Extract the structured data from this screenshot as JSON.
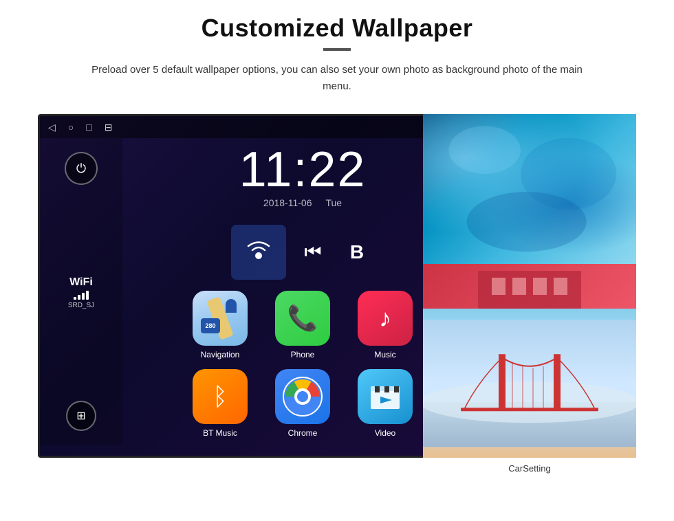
{
  "page": {
    "title": "Customized Wallpaper",
    "description": "Preload over 5 default wallpaper options, you can also set your own photo as background photo of the main menu."
  },
  "screen": {
    "time": "11:22",
    "date": "2018-11-06",
    "day": "Tue",
    "wifi_label": "WiFi",
    "wifi_ssid": "SRD_SJ"
  },
  "apps": [
    {
      "id": "navigation",
      "label": "Navigation"
    },
    {
      "id": "phone",
      "label": "Phone"
    },
    {
      "id": "music",
      "label": "Music"
    },
    {
      "id": "bt-music",
      "label": "BT Music"
    },
    {
      "id": "chrome",
      "label": "Chrome"
    },
    {
      "id": "video",
      "label": "Video"
    }
  ],
  "sidebar": {
    "car_setting_label": "CarSetting"
  },
  "colors": {
    "accent": "#4285f4",
    "background_dark": "#1a1040"
  }
}
